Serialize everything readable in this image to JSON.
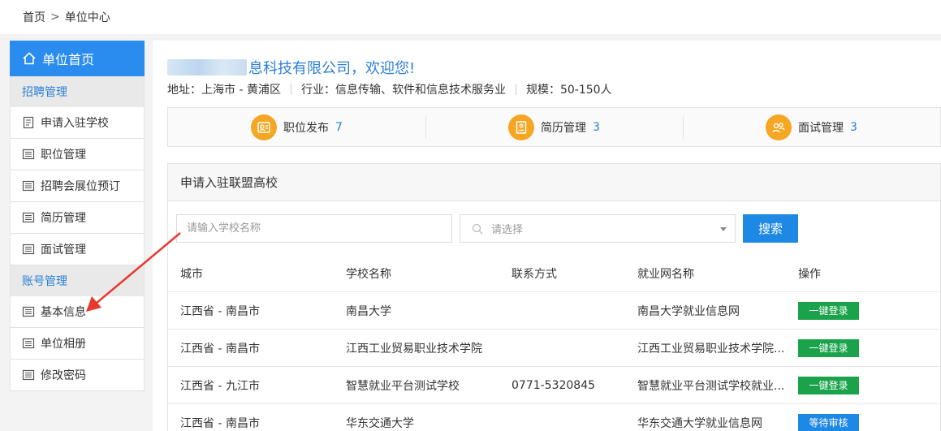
{
  "breadcrumb": {
    "home": "首页",
    "sep": ">",
    "current": "单位中心"
  },
  "sidebar": {
    "home": "单位首页",
    "groups": [
      {
        "title": "招聘管理",
        "items": [
          "申请入驻学校",
          "职位管理",
          "招聘会展位预订",
          "简历管理",
          "面试管理"
        ]
      },
      {
        "title": "账号管理",
        "items": [
          "基本信息",
          "单位相册",
          "修改密码"
        ]
      }
    ]
  },
  "company": {
    "name_visible": "息科技有限公司，欢迎您!",
    "address_label": "地址：",
    "address": "上海市 - 黄浦区",
    "industry_label": "行业：",
    "industry": "信息传输、软件和信息技术服务业",
    "scale_label": "规模：",
    "scale": "50-150人"
  },
  "stats": [
    {
      "label": "职位发布",
      "count": "7",
      "icon": "job-post-icon"
    },
    {
      "label": "简历管理",
      "count": "3",
      "icon": "resume-icon"
    },
    {
      "label": "面试管理",
      "count": "3",
      "icon": "interview-icon"
    }
  ],
  "panel": {
    "title": "申请入驻联盟高校",
    "school_placeholder": "请输入学校名称",
    "select_placeholder": "请选择",
    "search_label": "搜索"
  },
  "table": {
    "headers": [
      "城市",
      "学校名称",
      "联系方式",
      "就业网名称",
      "操作"
    ],
    "rows": [
      {
        "city": "江西省 - 南昌市",
        "school": "南昌大学",
        "contact": "",
        "site": "南昌大学就业信息网",
        "action": "一键登录",
        "status": "login"
      },
      {
        "city": "江西省 - 南昌市",
        "school": "江西工业贸易职业技术学院",
        "contact": "",
        "site": "江西工业贸易职业技术学院...",
        "action": "一键登录",
        "status": "login"
      },
      {
        "city": "江西省 - 九江市",
        "school": "智慧就业平台测试学校",
        "contact": "0771-5320845",
        "site": "智慧就业平台测试学校就业...",
        "action": "一键登录",
        "status": "login"
      },
      {
        "city": "江西省 - 南昌市",
        "school": "华东交通大学",
        "contact": "",
        "site": "华东交通大学就业信息网",
        "action": "等待审核",
        "status": "wait"
      }
    ]
  },
  "colors": {
    "primary": "#2b8cf0",
    "accent": "#f5a623",
    "success": "#1aa34a",
    "annotation": "#e8392f"
  }
}
